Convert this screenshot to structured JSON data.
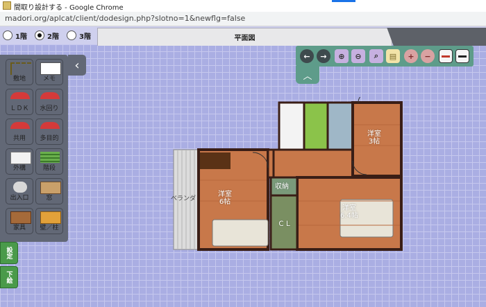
{
  "window": {
    "title": "間取り設計する - Google Chrome",
    "accent": "#1a73e8"
  },
  "address_bar": {
    "url": "madori.org/aplcat/client/dodesign.php?slotno=1&newflg=false"
  },
  "floors": [
    {
      "label": "1階",
      "selected": false
    },
    {
      "label": "2階",
      "selected": true
    },
    {
      "label": "3階",
      "selected": false
    }
  ],
  "canvas_tab": {
    "label": "平面図"
  },
  "toolbar": {
    "buttons": [
      {
        "name": "undo",
        "icon": "arrow-left-icon"
      },
      {
        "name": "redo",
        "icon": "arrow-right-icon"
      },
      {
        "name": "zoom-in",
        "icon": "zoom-in-icon"
      },
      {
        "name": "zoom-out",
        "icon": "zoom-out-icon"
      },
      {
        "name": "zoom-fit",
        "icon": "zoom-fit-icon"
      },
      {
        "name": "document",
        "icon": "document-icon"
      },
      {
        "name": "add",
        "icon": "plus-circle-icon"
      },
      {
        "name": "remove",
        "icon": "minus-circle-icon"
      },
      {
        "name": "wall-red",
        "icon": "wall-red-icon"
      },
      {
        "name": "wall-dark",
        "icon": "wall-dark-icon"
      }
    ],
    "color": "#5e9c8a"
  },
  "palette": {
    "items": [
      {
        "label": "敷地",
        "color": "#e9d67a",
        "icon": "site-icon"
      },
      {
        "label": "メモ",
        "color": "#e9d67a",
        "icon": "memo-icon"
      },
      {
        "label": "ＬＤＫ",
        "color": "#7fd6d2",
        "icon": "ldk-umbrella-icon"
      },
      {
        "label": "水回り",
        "color": "#7fd6d2",
        "icon": "water-umbrella-icon"
      },
      {
        "label": "共用",
        "color": "#7fd6d2",
        "icon": "shared-umbrella-icon"
      },
      {
        "label": "多目的",
        "color": "#7fd6d2",
        "icon": "multipurpose-umbrella-icon"
      },
      {
        "label": "外構",
        "color": "#e79ad8",
        "icon": "exterior-icon"
      },
      {
        "label": "階段",
        "color": "#e79ad8",
        "icon": "stairs-icon"
      },
      {
        "label": "出入口",
        "color": "#a7e08c",
        "icon": "entrance-icon"
      },
      {
        "label": "窓",
        "color": "#a7e08c",
        "icon": "window-icon"
      },
      {
        "label": "家具",
        "color": "#e8e0cc",
        "icon": "furniture-icon"
      },
      {
        "label": "壁／柱",
        "color": "#e8e0cc",
        "icon": "wall-pillar-icon"
      }
    ]
  },
  "side_tabs": [
    {
      "label": "設定"
    },
    {
      "label": "下絵"
    }
  ],
  "plan": {
    "rooms": [
      {
        "name": "洋室",
        "size": "6帖"
      },
      {
        "name": "洋室",
        "size": "3帖"
      },
      {
        "name": "洋室",
        "size": "6.4帖"
      },
      {
        "name": "収納",
        "size": ""
      },
      {
        "name": "ＣＬ",
        "size": ""
      },
      {
        "name": "ベランダ",
        "size": ""
      }
    ],
    "colors": {
      "wall": "#3a1e16",
      "floor": "#c8784a",
      "bath": "#8bc34a",
      "stair": "#9fb7c7",
      "balcony": "#dcdcdc"
    }
  }
}
